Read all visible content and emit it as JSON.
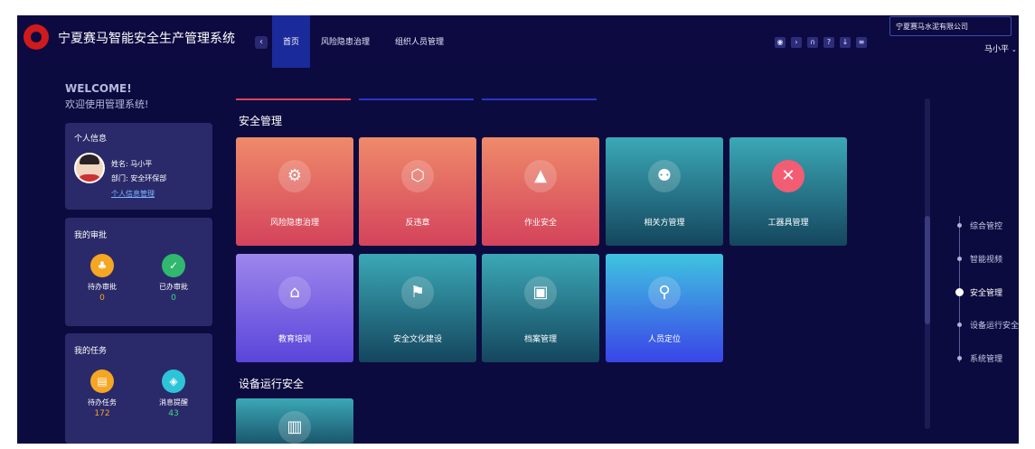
{
  "header": {
    "app_title": "宁夏赛马智能安全生产管理系统",
    "collapse_icon": "chevron-left-icon",
    "tabs": [
      {
        "label": "首页",
        "active": true
      },
      {
        "label": "风险隐患治理",
        "active": false
      },
      {
        "label": "组织人员管理",
        "active": false
      }
    ],
    "toolbar_icons": [
      "target-icon",
      "chevron-right-icon",
      "headset-icon",
      "help-icon",
      "download-icon",
      "menu-icon"
    ],
    "company": "宁夏赛马水泥有限公司",
    "user": "马小平"
  },
  "welcome": {
    "title": "WELCOME!",
    "subtitle": "欢迎使用管理系统!"
  },
  "personal": {
    "title": "个人信息",
    "name_line": "姓名: 马小平",
    "dept_line": "部门: 安全环保部",
    "link": "个人信息管理"
  },
  "approval": {
    "title": "我的审批",
    "pending_label": "待办审批",
    "pending_count": "0",
    "done_label": "已办审批",
    "done_count": "0"
  },
  "tasks": {
    "title": "我的任务",
    "todo_label": "待办任务",
    "todo_count": "172",
    "msg_label": "消息提醒",
    "msg_count": "43"
  },
  "safety": {
    "title": "安全管理",
    "tiles": [
      {
        "label": "风险隐患治理",
        "icon": "gear-shield-icon"
      },
      {
        "label": "反违章",
        "icon": "warning-badge-icon"
      },
      {
        "label": "作业安全",
        "icon": "cone-warning-icon"
      },
      {
        "label": "相关方管理",
        "icon": "people-icon"
      },
      {
        "label": "工器具管理",
        "icon": "tools-icon"
      },
      {
        "label": "教育培训",
        "icon": "education-icon"
      },
      {
        "label": "安全文化建设",
        "icon": "flag-icon"
      },
      {
        "label": "档案管理",
        "icon": "archive-icon"
      },
      {
        "label": "人员定位",
        "icon": "location-pin-icon"
      }
    ]
  },
  "equipment": {
    "title": "设备运行安全",
    "tile_icon": "equipment-icon"
  },
  "sidenav": {
    "items": [
      {
        "label": "综合管控",
        "active": false
      },
      {
        "label": "智能视频",
        "active": false
      },
      {
        "label": "安全管理",
        "active": true
      },
      {
        "label": "设备运行安全",
        "active": false
      },
      {
        "label": "系统管理",
        "active": false
      }
    ]
  },
  "colors": {
    "background": "#0c0b3f",
    "tile_red_top": "#ef8a6a",
    "tile_teal": "#3ba8b6",
    "tile_purple": "#9e86ec",
    "tile_blue": "#3fc4e0",
    "approval_orange": "#f5a623",
    "approval_green": "#2fb86e",
    "count_orange": "#f5a623",
    "count_green": "#3ddc84"
  }
}
